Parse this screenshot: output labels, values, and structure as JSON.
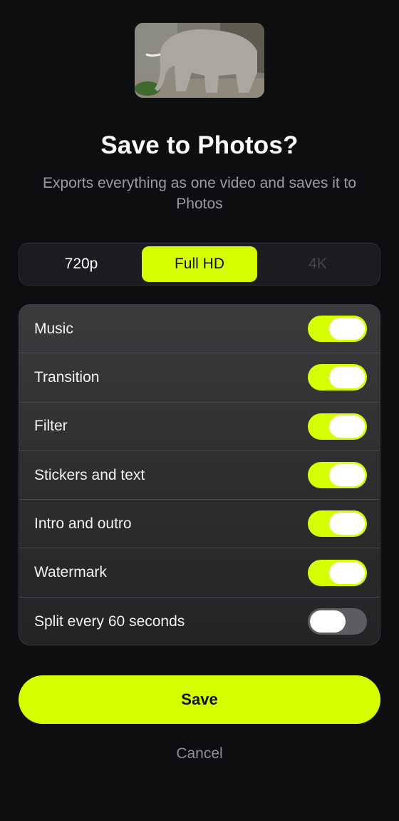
{
  "dialog": {
    "title": "Save to Photos?",
    "subtitle": "Exports everything as one video and saves it to Photos"
  },
  "resolution": {
    "options": [
      {
        "label": "720p",
        "state": "normal"
      },
      {
        "label": "Full HD",
        "state": "selected"
      },
      {
        "label": "4K",
        "state": "disabled"
      }
    ]
  },
  "options": [
    {
      "label": "Music",
      "on": true
    },
    {
      "label": "Transition",
      "on": true
    },
    {
      "label": "Filter",
      "on": true
    },
    {
      "label": "Stickers and text",
      "on": true
    },
    {
      "label": "Intro and outro",
      "on": true
    },
    {
      "label": "Watermark",
      "on": true
    },
    {
      "label": "Split every 60 seconds",
      "on": false
    }
  ],
  "actions": {
    "save_label": "Save",
    "cancel_label": "Cancel"
  },
  "colors": {
    "accent": "#d7ff00",
    "background": "#0d0e10",
    "toggle_off": "#5c5d60"
  }
}
